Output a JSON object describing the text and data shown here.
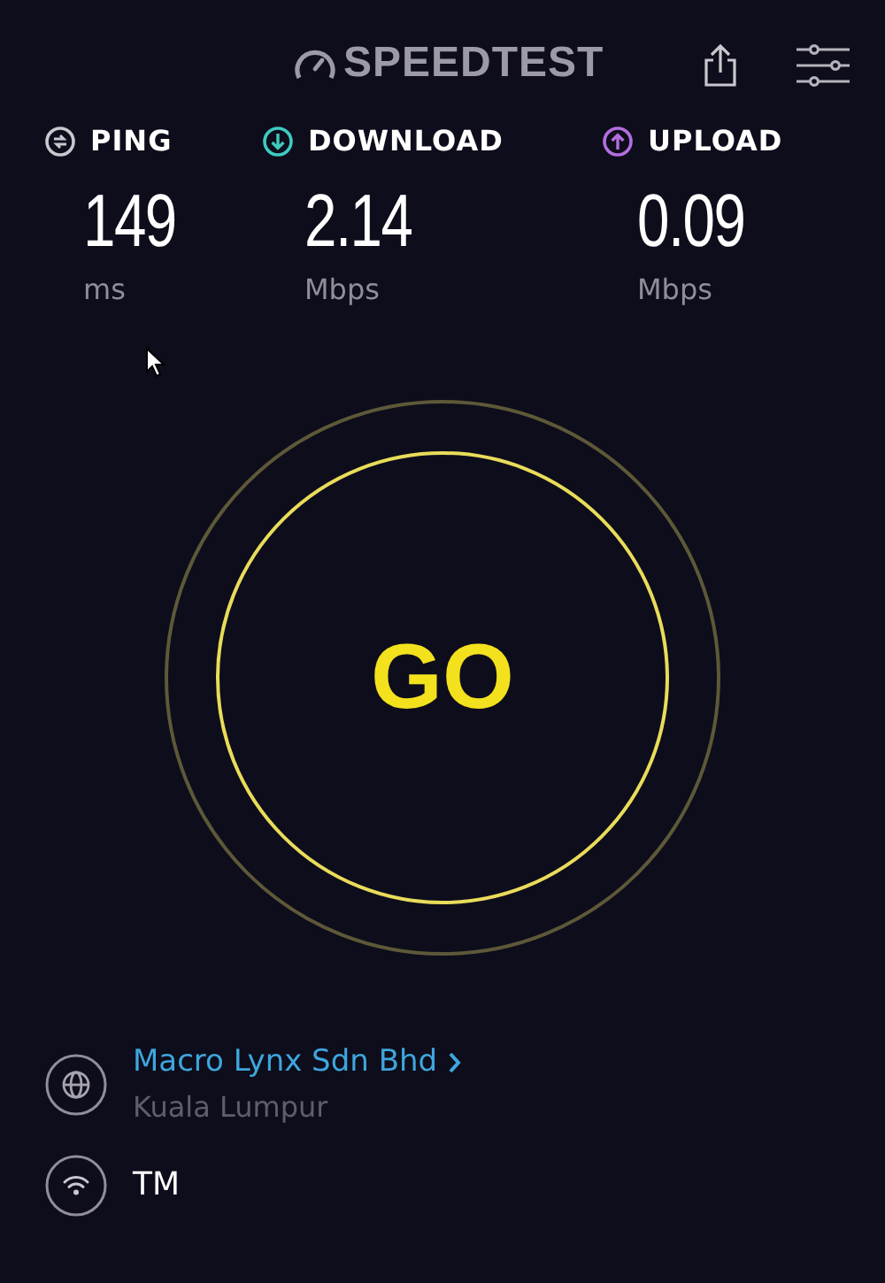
{
  "header": {
    "logo": "SPEEDTEST"
  },
  "metrics": [
    {
      "label": "PING",
      "value": "149",
      "unit": "ms",
      "kind": "ping",
      "color": "#c8c8cf"
    },
    {
      "label": "DOWNLOAD",
      "value": "2.14",
      "unit": "Mbps",
      "kind": "download",
      "color": "#3ecbc0"
    },
    {
      "label": "UPLOAD",
      "value": "0.09",
      "unit": "Mbps",
      "kind": "upload",
      "color": "#b36ee0"
    }
  ],
  "go_button": {
    "label": "GO"
  },
  "server": {
    "provider": "Macro Lynx Sdn Bhd",
    "location": "Kuala Lumpur"
  },
  "network": {
    "isp": "TM"
  }
}
